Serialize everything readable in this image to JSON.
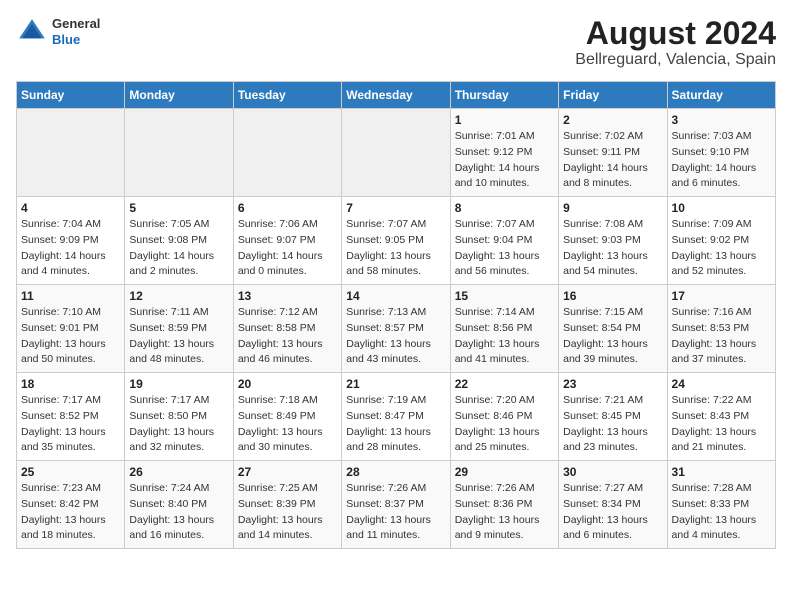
{
  "header": {
    "logo_general": "General",
    "logo_blue": "Blue",
    "title": "August 2024",
    "subtitle": "Bellreguard, Valencia, Spain"
  },
  "days_of_week": [
    "Sunday",
    "Monday",
    "Tuesday",
    "Wednesday",
    "Thursday",
    "Friday",
    "Saturday"
  ],
  "weeks": [
    {
      "days": [
        {
          "num": "",
          "empty": true
        },
        {
          "num": "",
          "empty": true
        },
        {
          "num": "",
          "empty": true
        },
        {
          "num": "",
          "empty": true
        },
        {
          "num": "1",
          "sunrise": "Sunrise: 7:01 AM",
          "sunset": "Sunset: 9:12 PM",
          "daylight": "Daylight: 14 hours and 10 minutes."
        },
        {
          "num": "2",
          "sunrise": "Sunrise: 7:02 AM",
          "sunset": "Sunset: 9:11 PM",
          "daylight": "Daylight: 14 hours and 8 minutes."
        },
        {
          "num": "3",
          "sunrise": "Sunrise: 7:03 AM",
          "sunset": "Sunset: 9:10 PM",
          "daylight": "Daylight: 14 hours and 6 minutes."
        }
      ]
    },
    {
      "days": [
        {
          "num": "4",
          "sunrise": "Sunrise: 7:04 AM",
          "sunset": "Sunset: 9:09 PM",
          "daylight": "Daylight: 14 hours and 4 minutes."
        },
        {
          "num": "5",
          "sunrise": "Sunrise: 7:05 AM",
          "sunset": "Sunset: 9:08 PM",
          "daylight": "Daylight: 14 hours and 2 minutes."
        },
        {
          "num": "6",
          "sunrise": "Sunrise: 7:06 AM",
          "sunset": "Sunset: 9:07 PM",
          "daylight": "Daylight: 14 hours and 0 minutes."
        },
        {
          "num": "7",
          "sunrise": "Sunrise: 7:07 AM",
          "sunset": "Sunset: 9:05 PM",
          "daylight": "Daylight: 13 hours and 58 minutes."
        },
        {
          "num": "8",
          "sunrise": "Sunrise: 7:07 AM",
          "sunset": "Sunset: 9:04 PM",
          "daylight": "Daylight: 13 hours and 56 minutes."
        },
        {
          "num": "9",
          "sunrise": "Sunrise: 7:08 AM",
          "sunset": "Sunset: 9:03 PM",
          "daylight": "Daylight: 13 hours and 54 minutes."
        },
        {
          "num": "10",
          "sunrise": "Sunrise: 7:09 AM",
          "sunset": "Sunset: 9:02 PM",
          "daylight": "Daylight: 13 hours and 52 minutes."
        }
      ]
    },
    {
      "days": [
        {
          "num": "11",
          "sunrise": "Sunrise: 7:10 AM",
          "sunset": "Sunset: 9:01 PM",
          "daylight": "Daylight: 13 hours and 50 minutes."
        },
        {
          "num": "12",
          "sunrise": "Sunrise: 7:11 AM",
          "sunset": "Sunset: 8:59 PM",
          "daylight": "Daylight: 13 hours and 48 minutes."
        },
        {
          "num": "13",
          "sunrise": "Sunrise: 7:12 AM",
          "sunset": "Sunset: 8:58 PM",
          "daylight": "Daylight: 13 hours and 46 minutes."
        },
        {
          "num": "14",
          "sunrise": "Sunrise: 7:13 AM",
          "sunset": "Sunset: 8:57 PM",
          "daylight": "Daylight: 13 hours and 43 minutes."
        },
        {
          "num": "15",
          "sunrise": "Sunrise: 7:14 AM",
          "sunset": "Sunset: 8:56 PM",
          "daylight": "Daylight: 13 hours and 41 minutes."
        },
        {
          "num": "16",
          "sunrise": "Sunrise: 7:15 AM",
          "sunset": "Sunset: 8:54 PM",
          "daylight": "Daylight: 13 hours and 39 minutes."
        },
        {
          "num": "17",
          "sunrise": "Sunrise: 7:16 AM",
          "sunset": "Sunset: 8:53 PM",
          "daylight": "Daylight: 13 hours and 37 minutes."
        }
      ]
    },
    {
      "days": [
        {
          "num": "18",
          "sunrise": "Sunrise: 7:17 AM",
          "sunset": "Sunset: 8:52 PM",
          "daylight": "Daylight: 13 hours and 35 minutes."
        },
        {
          "num": "19",
          "sunrise": "Sunrise: 7:17 AM",
          "sunset": "Sunset: 8:50 PM",
          "daylight": "Daylight: 13 hours and 32 minutes."
        },
        {
          "num": "20",
          "sunrise": "Sunrise: 7:18 AM",
          "sunset": "Sunset: 8:49 PM",
          "daylight": "Daylight: 13 hours and 30 minutes."
        },
        {
          "num": "21",
          "sunrise": "Sunrise: 7:19 AM",
          "sunset": "Sunset: 8:47 PM",
          "daylight": "Daylight: 13 hours and 28 minutes."
        },
        {
          "num": "22",
          "sunrise": "Sunrise: 7:20 AM",
          "sunset": "Sunset: 8:46 PM",
          "daylight": "Daylight: 13 hours and 25 minutes."
        },
        {
          "num": "23",
          "sunrise": "Sunrise: 7:21 AM",
          "sunset": "Sunset: 8:45 PM",
          "daylight": "Daylight: 13 hours and 23 minutes."
        },
        {
          "num": "24",
          "sunrise": "Sunrise: 7:22 AM",
          "sunset": "Sunset: 8:43 PM",
          "daylight": "Daylight: 13 hours and 21 minutes."
        }
      ]
    },
    {
      "days": [
        {
          "num": "25",
          "sunrise": "Sunrise: 7:23 AM",
          "sunset": "Sunset: 8:42 PM",
          "daylight": "Daylight: 13 hours and 18 minutes."
        },
        {
          "num": "26",
          "sunrise": "Sunrise: 7:24 AM",
          "sunset": "Sunset: 8:40 PM",
          "daylight": "Daylight: 13 hours and 16 minutes."
        },
        {
          "num": "27",
          "sunrise": "Sunrise: 7:25 AM",
          "sunset": "Sunset: 8:39 PM",
          "daylight": "Daylight: 13 hours and 14 minutes."
        },
        {
          "num": "28",
          "sunrise": "Sunrise: 7:26 AM",
          "sunset": "Sunset: 8:37 PM",
          "daylight": "Daylight: 13 hours and 11 minutes."
        },
        {
          "num": "29",
          "sunrise": "Sunrise: 7:26 AM",
          "sunset": "Sunset: 8:36 PM",
          "daylight": "Daylight: 13 hours and 9 minutes."
        },
        {
          "num": "30",
          "sunrise": "Sunrise: 7:27 AM",
          "sunset": "Sunset: 8:34 PM",
          "daylight": "Daylight: 13 hours and 6 minutes."
        },
        {
          "num": "31",
          "sunrise": "Sunrise: 7:28 AM",
          "sunset": "Sunset: 8:33 PM",
          "daylight": "Daylight: 13 hours and 4 minutes."
        }
      ]
    }
  ]
}
